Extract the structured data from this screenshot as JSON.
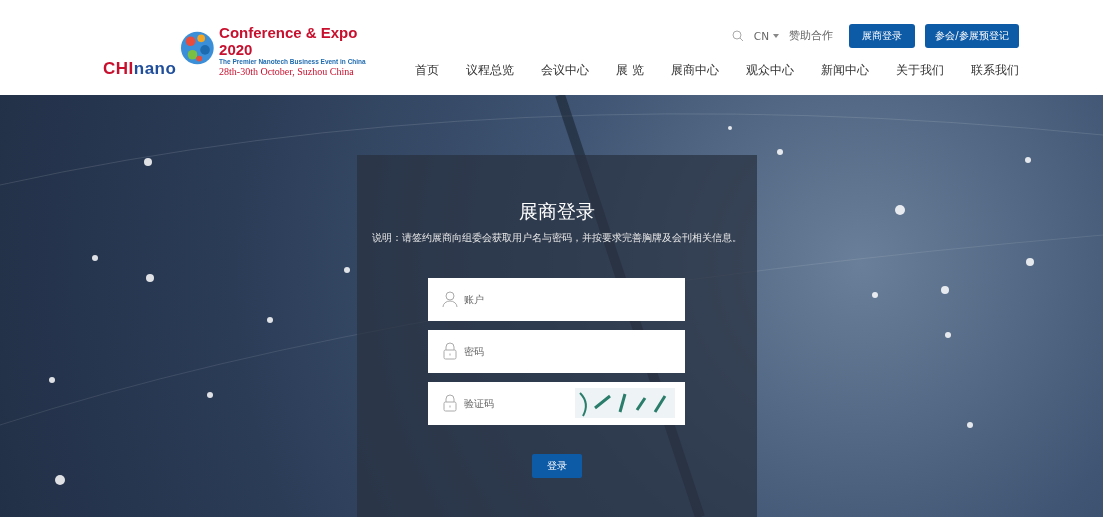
{
  "header": {
    "logo": {
      "wordmark": [
        {
          "text": "CHI",
          "color": "#c8102e"
        },
        {
          "text": "nano",
          "color": "#1f4e9c"
        }
      ],
      "title": "Conference & Expo 2020",
      "tagline": "The Premier Nanotech Business Event in China",
      "dates": "28th-30th October, Suzhou China"
    },
    "top_links": {
      "language": "CN",
      "sponsor": "赞助合作",
      "buttons": [
        "展商登录",
        "参会/参展预登记"
      ]
    },
    "nav": [
      "首页",
      "议程总览",
      "会议中心",
      "展 览",
      "展商中心",
      "观众中心",
      "新闻中心",
      "关于我们",
      "联系我们"
    ]
  },
  "login": {
    "title": "展商登录",
    "note": "说明：请签约展商向组委会获取用户名与密码，并按要求完善胸牌及会刊相关信息。",
    "fields": [
      {
        "kind": "user",
        "placeholder": "账户"
      },
      {
        "kind": "password",
        "placeholder": "密码"
      },
      {
        "kind": "captcha",
        "placeholder": "验证码"
      }
    ],
    "submit": "登录"
  }
}
